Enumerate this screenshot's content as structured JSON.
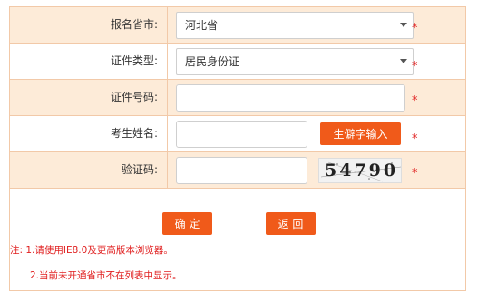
{
  "form": {
    "province": {
      "label": "报名省市:",
      "value": "河北省"
    },
    "id_type": {
      "label": "证件类型:",
      "value": "居民身份证"
    },
    "id_number": {
      "label": "证件号码:",
      "value": ""
    },
    "name": {
      "label": "考生姓名:",
      "value": "",
      "button_label": "生僻字输入"
    },
    "captcha": {
      "label": "验证码:",
      "value": "",
      "image_text": "54790"
    },
    "required_mark": "*"
  },
  "actions": {
    "confirm_label": "确 定",
    "back_label": "返 回"
  },
  "notes": {
    "line1": "注: 1.请使用IE8.0及更高版本浏览器。",
    "line2": "2.当前未开通省市不在列表中显示。"
  },
  "colors": {
    "accent": "#f05a1a",
    "row_highlight": "#fdebd8",
    "border": "#f2c9a8",
    "required": "#e02020"
  }
}
